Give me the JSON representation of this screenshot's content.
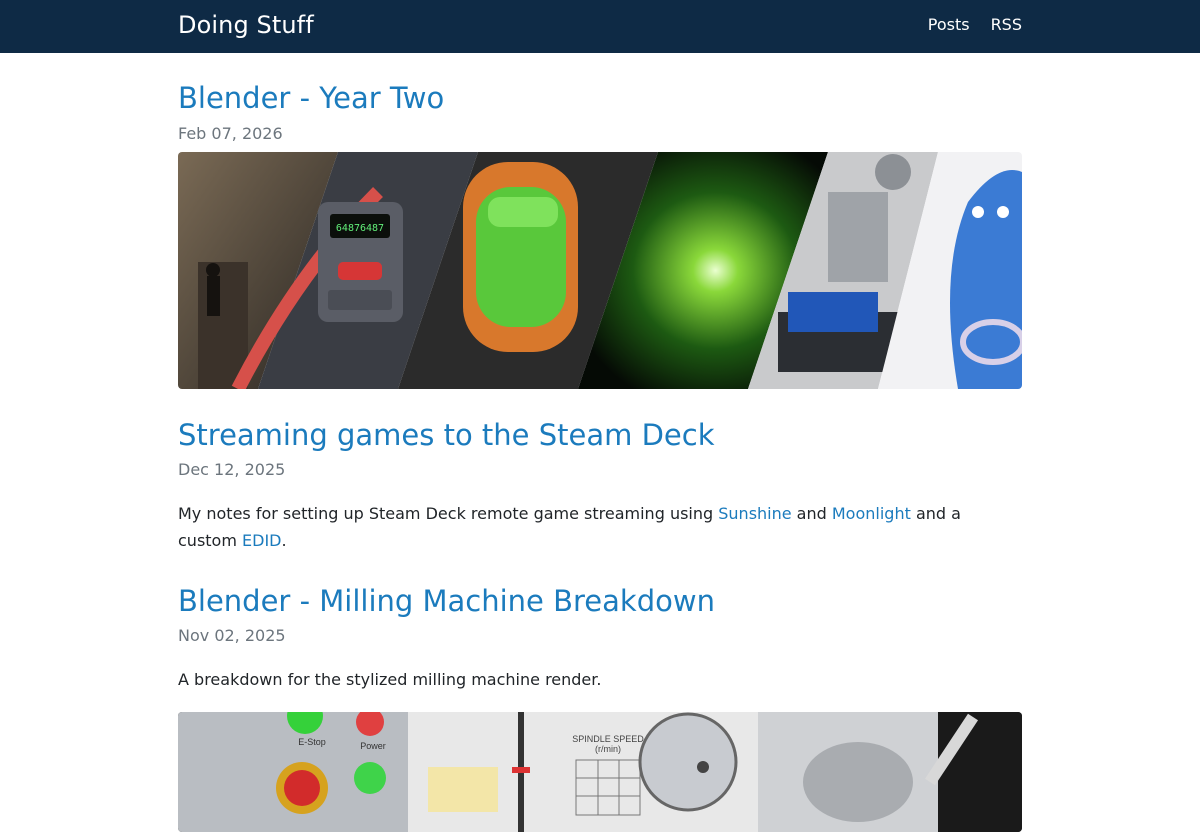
{
  "site": {
    "brand": "Doing Stuff",
    "nav": {
      "posts": "Posts",
      "rss": "RSS"
    }
  },
  "posts": [
    {
      "title": "Blender - Year Two",
      "date": "Feb 07, 2026",
      "image_text": {
        "display": "64876487"
      }
    },
    {
      "title": "Streaming games to the Steam Deck",
      "date": "Dec 12, 2025",
      "summary": {
        "before": "My notes for setting up Steam Deck remote game streaming using ",
        "link1": "Sunshine",
        "mid1": " and ",
        "link2": "Moonlight",
        "mid2": " and a custom ",
        "link3": "EDID",
        "after": "."
      }
    },
    {
      "title": "Blender - Milling Machine Breakdown",
      "date": "Nov 02, 2025",
      "summary": "A breakdown for the stylized milling machine render.",
      "image_text": {
        "estop": "E-Stop",
        "power": "Power",
        "spindle_speed": "SPINDLE SPEED",
        "rpm": "(r/min)"
      }
    }
  ],
  "colors": {
    "navbar": "#0e2a45",
    "link": "#1b7bbd",
    "date": "#6c757d"
  }
}
